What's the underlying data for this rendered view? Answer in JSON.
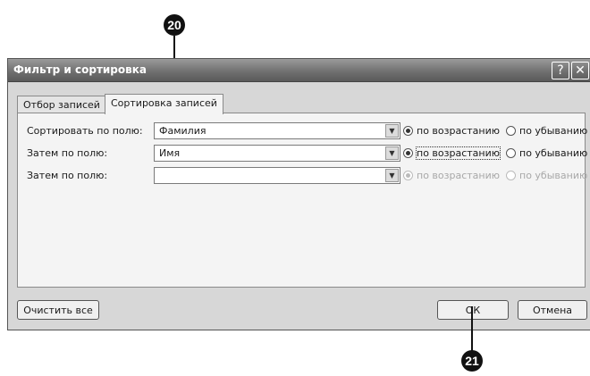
{
  "callouts": {
    "top": "20",
    "bottom": "21"
  },
  "window": {
    "title": "Фильтр и сортировка",
    "help_glyph": "?",
    "close_glyph": "✕"
  },
  "tabs": [
    {
      "label": "Отбор записей",
      "active": false
    },
    {
      "label": "Сортировка записей",
      "active": true
    }
  ],
  "rows": [
    {
      "label": "Сортировать по полю:",
      "value": "Фамилия",
      "asc": "по возрастанию",
      "desc": "по убыванию",
      "selected": "asc",
      "enabled": true
    },
    {
      "label": "Затем по полю:",
      "value": "Имя",
      "asc": "по возрастанию",
      "desc": "по убыванию",
      "selected": "asc",
      "enabled": true
    },
    {
      "label": "Затем по полю:",
      "value": "",
      "asc": "по возрастанию",
      "desc": "по убыванию",
      "selected": "asc",
      "enabled": false
    }
  ],
  "buttons": {
    "clear": "Очистить все",
    "ok": "ОК",
    "cancel": "Отмена"
  },
  "icons": {
    "dropdown": "chevron-down-icon"
  }
}
